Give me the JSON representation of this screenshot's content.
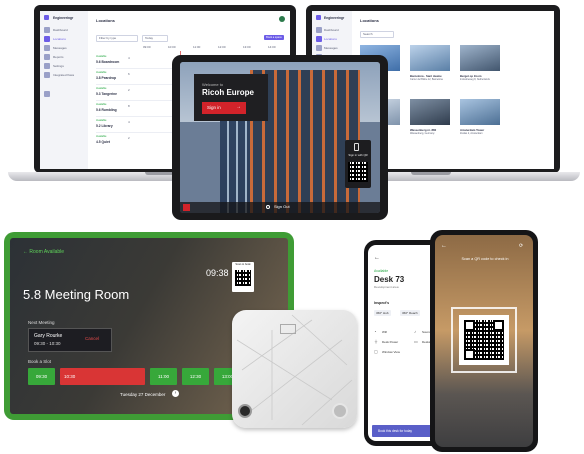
{
  "laptop_left": {
    "brand": "Engineeringr",
    "title": "Locations",
    "search_placeholder": "Filter by type",
    "date_chip": "Today",
    "action_button": "Book a space",
    "time_headers": [
      "09:00",
      "10:00",
      "11:00",
      "12:00",
      "13:00",
      "14:00"
    ],
    "nav_items": [
      "Dashboard",
      "Locations",
      "Messages",
      "Reports",
      "Settings",
      "Integrated flows"
    ],
    "rows": [
      {
        "status": "Available",
        "name": "5.6 Boardroom",
        "count": "4"
      },
      {
        "status": "Available",
        "name": "3.8 Peardrop",
        "count": "6"
      },
      {
        "status": "Available",
        "name": "5.3 Tangerine",
        "count": "2"
      },
      {
        "status": "Available",
        "name": "5.6 Rumbling",
        "count": "8"
      },
      {
        "status": "Available",
        "name": "5.2 Library",
        "count": "4"
      },
      {
        "status": "Available",
        "name": "4.5 Quiet",
        "count": "2"
      }
    ]
  },
  "laptop_right": {
    "brand": "Engineeringr",
    "title": "Locations",
    "search_placeholder": "Search",
    "nav_items": [
      "Dashboard",
      "Locations",
      "Messages",
      "Reports",
      "Settings"
    ],
    "cards": [
      {
        "name": "Ricoh Europe",
        "sub": "20 Triton Street, London"
      },
      {
        "name": "Barcelona · Sant Jaume",
        "sub": "Carrer del Bisbe 12, Barcelona"
      },
      {
        "name": "Berget op Zoom",
        "sub": "Industrieweg 8, Netherlands"
      },
      {
        "name": "Ricoh London",
        "sub": "Triton Square, London"
      },
      {
        "name": "Wassenberg nr. 880",
        "sub": "Wassenberg, Germany"
      },
      {
        "name": "Amsterdam Tower",
        "sub": "Zuidas 2, Amsterdam"
      }
    ]
  },
  "tablet": {
    "welcome": "Welcome to",
    "location": "Ricoh Europe",
    "sign_in": "Sign in",
    "qr_caption": "Sign in with QR",
    "sign_out": "Sign Out"
  },
  "room_display": {
    "status": "Room Available",
    "clock": "09:38",
    "qr_caption": "Scan to book",
    "room_name": "5.8 Meeting Room",
    "next_meeting_label": "Next Meeting",
    "organizer": "Gary Rourke",
    "meeting_time": "09:30 - 10:30",
    "cancel": "Cancel",
    "book_label": "Book a Slot",
    "slots": [
      {
        "label": "09:30",
        "color": "#37a83a"
      },
      {
        "label": "10:30",
        "color": "#d93535"
      },
      {
        "label": "11:00",
        "color": "#37a83a"
      },
      {
        "label": "12:30",
        "color": "#37a83a"
      },
      {
        "label": "13:00",
        "color": "#37a83a"
      }
    ],
    "date": "Tuesday 27 December"
  },
  "phone_left": {
    "back": "←",
    "status": "Available",
    "desk": "Desk 73",
    "desk_sub": "Development area",
    "section": "Inspect’s",
    "tags": [
      "360° Hub",
      "360° Reach"
    ],
    "amenities": [
      "Wifi",
      "Desk Power",
      "Window View",
      "Sound",
      "Desks"
    ],
    "cta": "Book this desk for today"
  },
  "phone_right": {
    "scan_text": "Scan a QR code to check in"
  },
  "colors": {
    "accent": "#6c5ce7",
    "ricoh_red": "#d2232a",
    "available_green": "#3f9c35",
    "busy_red": "#d93535"
  }
}
